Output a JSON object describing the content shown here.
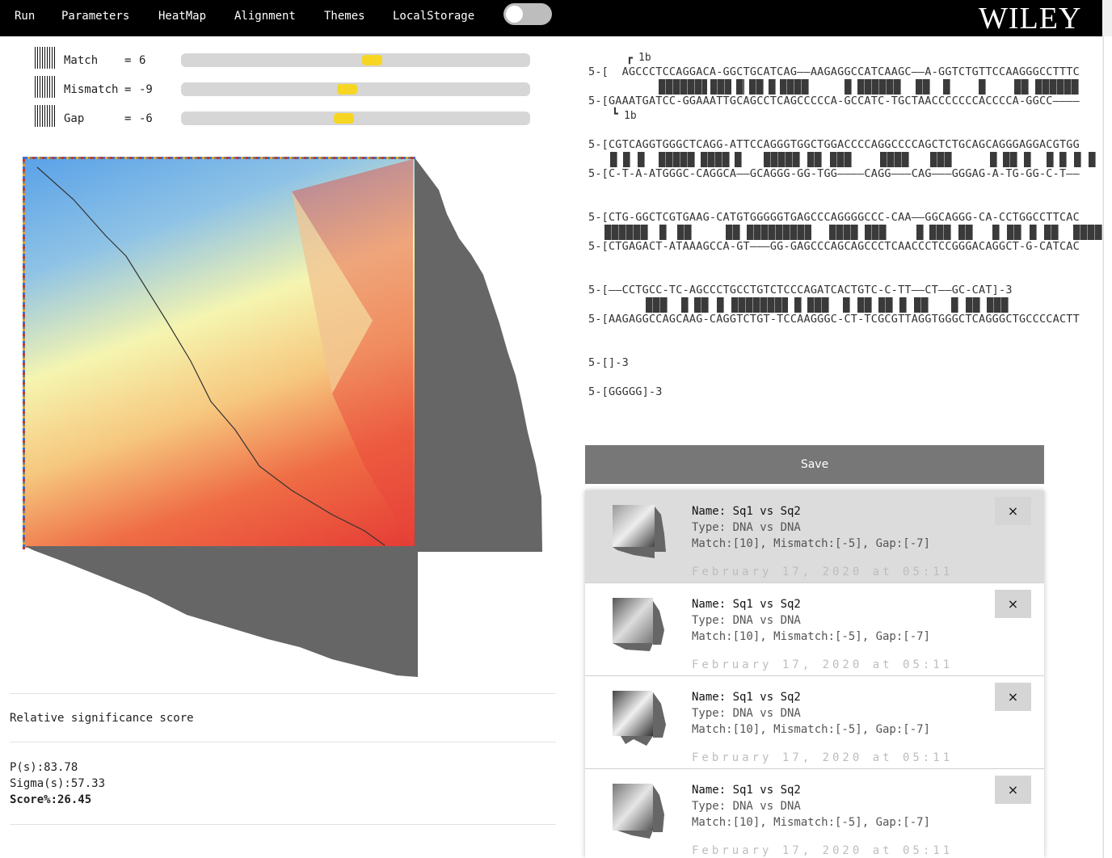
{
  "menu": [
    "Run",
    "Parameters",
    "HeatMap",
    "Alignment",
    "Themes",
    "LocalStorage"
  ],
  "brand": "WILEY",
  "theme_toggle": {
    "on": false
  },
  "params": [
    {
      "label": "Match",
      "value": "6",
      "level": 0.55
    },
    {
      "label": "Mismatch",
      "value": "-9",
      "level": 0.475
    },
    {
      "label": "Gap",
      "value": "-6",
      "level": 0.465
    }
  ],
  "stats": {
    "heading": "Relative significance score",
    "ps": "P(s):83.78",
    "sigma": "Sigma(s):57.33",
    "score": "Score%:26.45"
  },
  "alignment": {
    "marker_top": "1b",
    "marker_bottom": "1b",
    "blocks": [
      {
        "top": "5-[  AGCCCTCCAGGACA-GGCTGCATCAG——AAGAGGCCATCAAGC——A-GGTCTGTTCCAAGGGCCTTTC",
        "bottom": "5-[GAAATGATCC-GGAAATTGCAGCCTCAGCCCCCA-GCCATC-TGCTAACCCCCCCACCCCA-GGCC————"
      },
      {
        "top": "5-[CGTCAGGTGGGCTCAGG-ATTCCAGGGTGGCTGGACCCCAGGCCCCAGCTCTGCAGCAGGGAGGACGTGG",
        "bottom": "5-[C-T-A-ATGGGC-CAGGCA——GCAGGG-GG-TGG————CAGG———CAG———GGGAG-A-TG-GG-C-T——"
      },
      {
        "top": "5-[CTG-GGCTCGTGAAG-CATGTGGGGGTGAGCCCAGGGGCCC-CAA——GGCAGGG-CA-CCTGGCCTTCAC",
        "bottom": "5-[CTGAGACT-ATAAAGCCA-GT———GG-GAGCCCAGCAGCCCTCAACCCTCCGGGACAGGCT-G-CATCAC"
      },
      {
        "top": "5-[——CCTGCC-TC-AGCCCTGCCTGTCTCCCAGATCACTGTC-C-TT——CT——GC-CAT]-3",
        "bottom": "5-[AAGAGGCCAGCAAG-CAGGTCTGT-TCCAAGGGC-CT-TCGCGTTAGGTGGGCTCAGGGCTGCCCCACTT"
      }
    ],
    "tail": [
      "5-[]-3",
      "5-[GGGGG]-3"
    ]
  },
  "save_label": "Save",
  "saved": [
    {
      "name": "Name: Sq1 vs Sq2",
      "type": "Type: DNA vs DNA",
      "params": "Match:[10], Mismatch:[-5], Gap:[-7]",
      "date": "February 17, 2020 at 05:11",
      "close": "×"
    },
    {
      "name": "Name: Sq1 vs Sq2",
      "type": "Type: DNA vs DNA",
      "params": "Match:[10], Mismatch:[-5], Gap:[-7]",
      "date": "February 17, 2020 at 05:11",
      "close": "×"
    },
    {
      "name": "Name: Sq1 vs Sq2",
      "type": "Type: DNA vs DNA",
      "params": "Match:[10], Mismatch:[-5], Gap:[-7]",
      "date": "February 17, 2020 at 05:11",
      "close": "×"
    },
    {
      "name": "Name: Sq1 vs Sq2",
      "type": "Type: DNA vs DNA",
      "params": "Match:[10], Mismatch:[-5], Gap:[-7]",
      "date": "February 17, 2020 at 05:11",
      "close": "×"
    }
  ],
  "colors": {
    "accent": "#f7d623",
    "heat_low": "#5aa2e8",
    "heat_mid": "#f5f5b0",
    "heat_high": "#e53b35",
    "profile": "#666666"
  }
}
